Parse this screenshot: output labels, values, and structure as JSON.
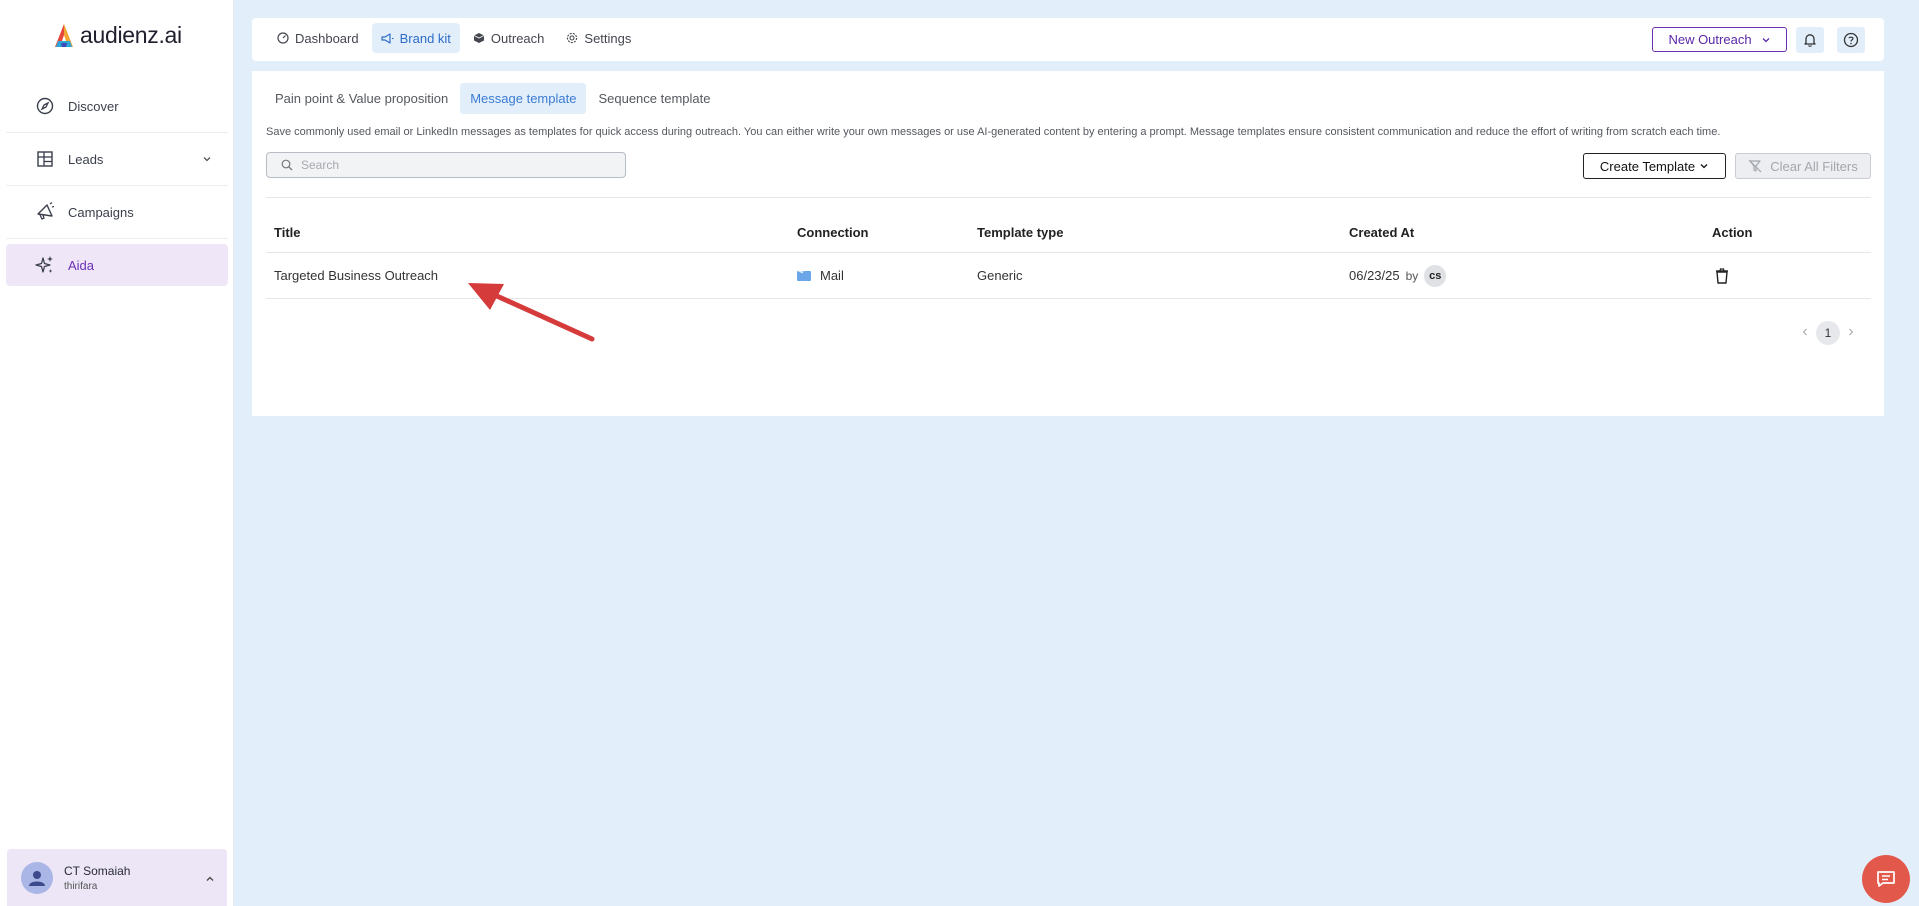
{
  "brand": {
    "name": "audienz.ai"
  },
  "sidebar": {
    "items": [
      {
        "label": "Discover",
        "icon": "compass-icon"
      },
      {
        "label": "Leads",
        "icon": "table-icon"
      },
      {
        "label": "Campaigns",
        "icon": "megaphone-icon"
      },
      {
        "label": "Aida",
        "icon": "sparkle-icon",
        "active": true
      }
    ],
    "user": {
      "name": "CT Somaiah",
      "org": "thirifara"
    }
  },
  "topnav": {
    "items": [
      {
        "label": "Dashboard"
      },
      {
        "label": "Brand kit",
        "active": true
      },
      {
        "label": "Outreach"
      },
      {
        "label": "Settings"
      }
    ],
    "new_outreach_label": "New Outreach"
  },
  "subtabs": [
    {
      "label": "Pain point & Value proposition"
    },
    {
      "label": "Message template",
      "active": true
    },
    {
      "label": "Sequence template"
    }
  ],
  "description": "Save commonly used email or LinkedIn messages as templates for quick access during outreach. You can either write your own messages or use AI-generated content by entering a prompt. Message templates ensure consistent communication and reduce the effort of writing from scratch each time.",
  "search": {
    "placeholder": "Search",
    "value": ""
  },
  "toolbar": {
    "create_label": "Create Template",
    "clear_label": "Clear All Filters"
  },
  "table": {
    "headers": [
      "Title",
      "Connection",
      "Template type",
      "Created At",
      "Action"
    ],
    "rows": [
      {
        "title": "Targeted Business Outreach",
        "connection": "Mail",
        "type": "Generic",
        "date": "06/23/25",
        "by": "by",
        "initials": "cs"
      }
    ]
  },
  "pagination": {
    "current": "1"
  },
  "colors": {
    "accent": "#6a2fb5",
    "brand_blue": "#3b7bd4",
    "background": "#e2effb",
    "annotation_arrow": "#d63b3b",
    "chat": "#e2584a"
  }
}
